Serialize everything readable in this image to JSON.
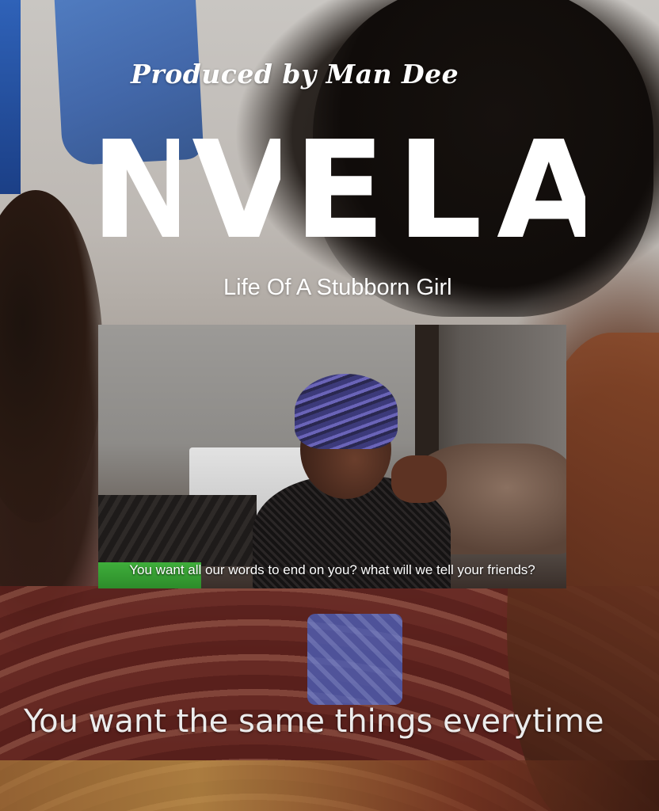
{
  "poster": {
    "producer_credit": "Produced by Man Dee",
    "title_letters": [
      "N",
      "V",
      "E",
      "L",
      "A"
    ],
    "tagline": "Life Of A Stubborn Girl",
    "inset_subtitle": "You want all our words to end on you? what will we tell your friends?",
    "bottom_subtitle": "You want the same things everytime"
  }
}
